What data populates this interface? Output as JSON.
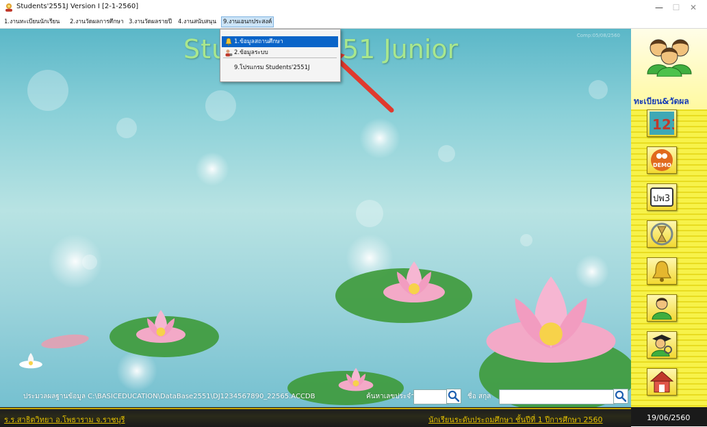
{
  "window": {
    "title": "Students'2551J Version I [2-1-2560]",
    "minimize_symbol": "—",
    "maximize_symbol": "☐",
    "close_symbol": "✕"
  },
  "menubar": {
    "items": [
      {
        "label": "1.งานทะเบียนนักเรียน"
      },
      {
        "label": "2.งานวัดผลการศึกษา"
      },
      {
        "label": "3.งานวัดผลรายปี"
      },
      {
        "label": "4.งานสนับสนุน"
      },
      {
        "label": "9.งานเอนกประสงค์"
      }
    ]
  },
  "dropdown": {
    "items": [
      {
        "label": "1.ข้อมูลสถานศึกษา",
        "icon": "bell-icon",
        "highlighted": true
      },
      {
        "label": "2.ข้อมูลระบบ",
        "icon": "user-gear-icon",
        "highlighted": false
      },
      {
        "label": "9.โปรแกรม Students'2551J",
        "icon": "",
        "highlighted": false
      }
    ]
  },
  "main": {
    "title_left": "Stu",
    "title_right": "51 Junior",
    "comp_label": "Comp:05/08/2560"
  },
  "bottom_bar": {
    "db_path": "ประมวลผลฐานข้อมูล C:\\BASICEDUCATION\\DataBase2551\\DJ1234567890_22565.ACCDB",
    "search_id_label": "ค้นหาเลขประจำตัว",
    "name_label": "ชื่อ  สกุล",
    "search_id_value": "",
    "name_value": ""
  },
  "status": {
    "school": "ร.ร.สาธิตวิทยา  อ.โพธาราม  จ.ราชบุรี",
    "level": "นักเรียนระดับประถมศึกษา  ชั้นปีที่ 1  ปีการศึกษา 2560",
    "date": "19/06/2560"
  },
  "sidebar": {
    "header_label": "ทะเบียน&วัดผล",
    "buttons": [
      {
        "icon": "numbers-123-icon",
        "text": "123"
      },
      {
        "icon": "demo-user-icon",
        "text": "DEMO"
      },
      {
        "icon": "pw3-document-icon",
        "text": "ปพ3"
      },
      {
        "icon": "hourglass-icon",
        "text": ""
      },
      {
        "icon": "bell-icon",
        "text": ""
      },
      {
        "icon": "user-icon",
        "text": ""
      },
      {
        "icon": "graduate-icon",
        "text": ""
      },
      {
        "icon": "home-icon",
        "text": ""
      }
    ]
  },
  "colors": {
    "accent_yellow": "#e6c200",
    "sidebar_label": "#1a3fb5",
    "menu_highlight": "#0a64c8",
    "arrow_red": "#e03a2e"
  }
}
